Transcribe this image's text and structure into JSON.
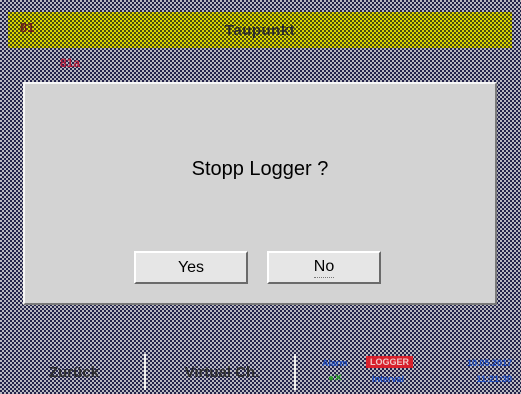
{
  "header": {
    "prefix": "81",
    "title": "Taupunkt"
  },
  "background_label": "81a",
  "dialog": {
    "message": "Stopp Logger ?",
    "yes_label": "Yes",
    "no_label": "No"
  },
  "softkeys": {
    "back_label": "Zurück",
    "virtual_label": "Virtual Ch."
  },
  "status": {
    "alarm_label": "Alarm",
    "logger_badge": "LOGGER",
    "date": "10.05.2017",
    "interval_label": "Interval",
    "time": "11:21:30"
  },
  "colors": {
    "title_bar": "#d8d400",
    "dialog_bg": "#d3d3d3",
    "alarm_badge": "#d8202c",
    "status_text": "#1e50c8"
  }
}
